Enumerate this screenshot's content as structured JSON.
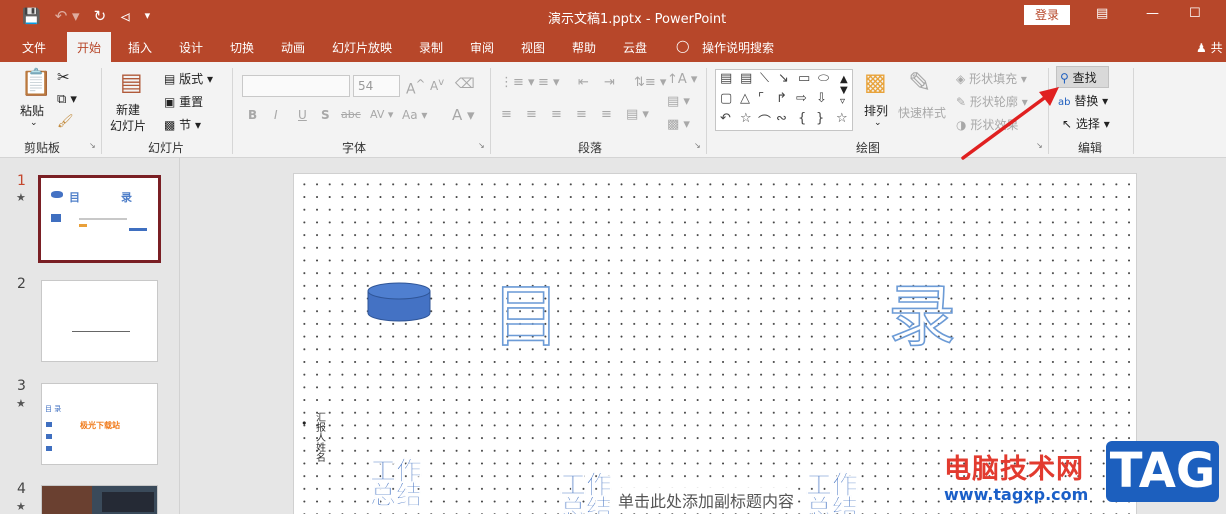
{
  "titlebar": {
    "document_title": "演示文稿1.pptx  -  PowerPoint",
    "login_label": "登录",
    "qat_icons": [
      "save-icon",
      "undo-icon",
      "redo-icon",
      "present-icon",
      "customize-icon"
    ]
  },
  "tabs": [
    {
      "label": "文件"
    },
    {
      "label": "开始"
    },
    {
      "label": "插入"
    },
    {
      "label": "设计"
    },
    {
      "label": "切换"
    },
    {
      "label": "动画"
    },
    {
      "label": "幻灯片放映"
    },
    {
      "label": "录制"
    },
    {
      "label": "审阅"
    },
    {
      "label": "视图"
    },
    {
      "label": "帮助"
    },
    {
      "label": "云盘"
    },
    {
      "label": "操作说明搜索"
    }
  ],
  "share_label": "共",
  "ribbon": {
    "clipboard": {
      "group": "剪贴板",
      "paste": "粘贴"
    },
    "slides": {
      "group": "幻灯片",
      "new_slide": "新建\n幻灯片",
      "layout": "版式",
      "reset": "重置",
      "section": "节"
    },
    "font": {
      "group": "字体",
      "font_size": "54",
      "bold": "B",
      "italic": "I",
      "underline": "U",
      "shadow": "S",
      "strike": "abc",
      "spacing": "AV",
      "case": "Aa",
      "color": "A"
    },
    "paragraph": {
      "group": "段落"
    },
    "drawing": {
      "group": "绘图",
      "arrange": "排列",
      "quick_styles": "快速样式",
      "shape_fill": "形状填充",
      "shape_outline": "形状轮廓",
      "shape_effects": "形状效果"
    },
    "editing": {
      "group": "编辑",
      "find": "查找",
      "replace": "替换",
      "select": "选择"
    }
  },
  "thumbnails": [
    {
      "number": "1",
      "star": "★",
      "selected": true
    },
    {
      "number": "2",
      "star": "",
      "selected": false
    },
    {
      "number": "3",
      "star": "★",
      "selected": false
    },
    {
      "number": "4",
      "star": "★",
      "selected": false
    }
  ],
  "thumb1": {
    "mu": "目",
    "lu": "录"
  },
  "thumb3": {
    "title": "目 录",
    "highlight": "极光下载站"
  },
  "slide": {
    "char_mu": "目",
    "char_lu": "录",
    "vertical_text": "汇报人姓名",
    "work_summary_1": "工作\n总结",
    "work_summary_2": "工作\n总结",
    "work_summary_3": "工作\n总结",
    "subtitle_placeholder": "单击此处添加副标题内容",
    "bullet": "•"
  },
  "watermark": {
    "site_name": "电脑技术网",
    "url": "www.tagxp.com",
    "logo_text": "TAG"
  },
  "colors": {
    "accent": "#b7472a",
    "selected_thumb_border": "#7a1f24",
    "cylinder": "#4472c4",
    "arrow": "#e02020"
  }
}
